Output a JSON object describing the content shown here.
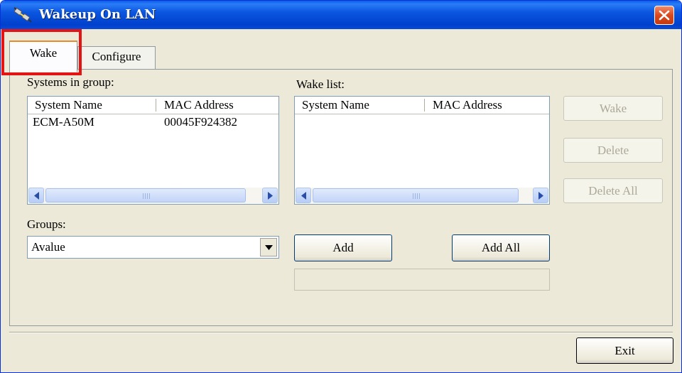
{
  "window": {
    "title": "Wakeup On LAN"
  },
  "tabs": [
    {
      "label": "Wake",
      "active": true
    },
    {
      "label": "Configure",
      "active": false
    }
  ],
  "systems": {
    "label": "Systems in group:",
    "columns": [
      "System Name",
      "MAC Address"
    ],
    "rows": [
      {
        "name": "ECM-A50M",
        "mac": "00045F924382"
      }
    ]
  },
  "wake_list": {
    "label": "Wake list:",
    "columns": [
      "System Name",
      "MAC Address"
    ],
    "rows": []
  },
  "buttons": {
    "wake": "Wake",
    "delete": "Delete",
    "delete_all": "Delete All",
    "add": "Add",
    "add_all": "Add All",
    "exit": "Exit"
  },
  "groups": {
    "label": "Groups:",
    "selected": "Avalue"
  },
  "icons": {
    "app": "network-plug-icon",
    "close": "close-icon",
    "scroll_left": "arrow-left-icon",
    "scroll_right": "arrow-right-icon",
    "dropdown": "chevron-down-icon"
  },
  "colors": {
    "titlebar": "#0a5fe8",
    "window_bg": "#ece9d8",
    "highlight": "#e31414",
    "close_button": "#d9491d"
  }
}
